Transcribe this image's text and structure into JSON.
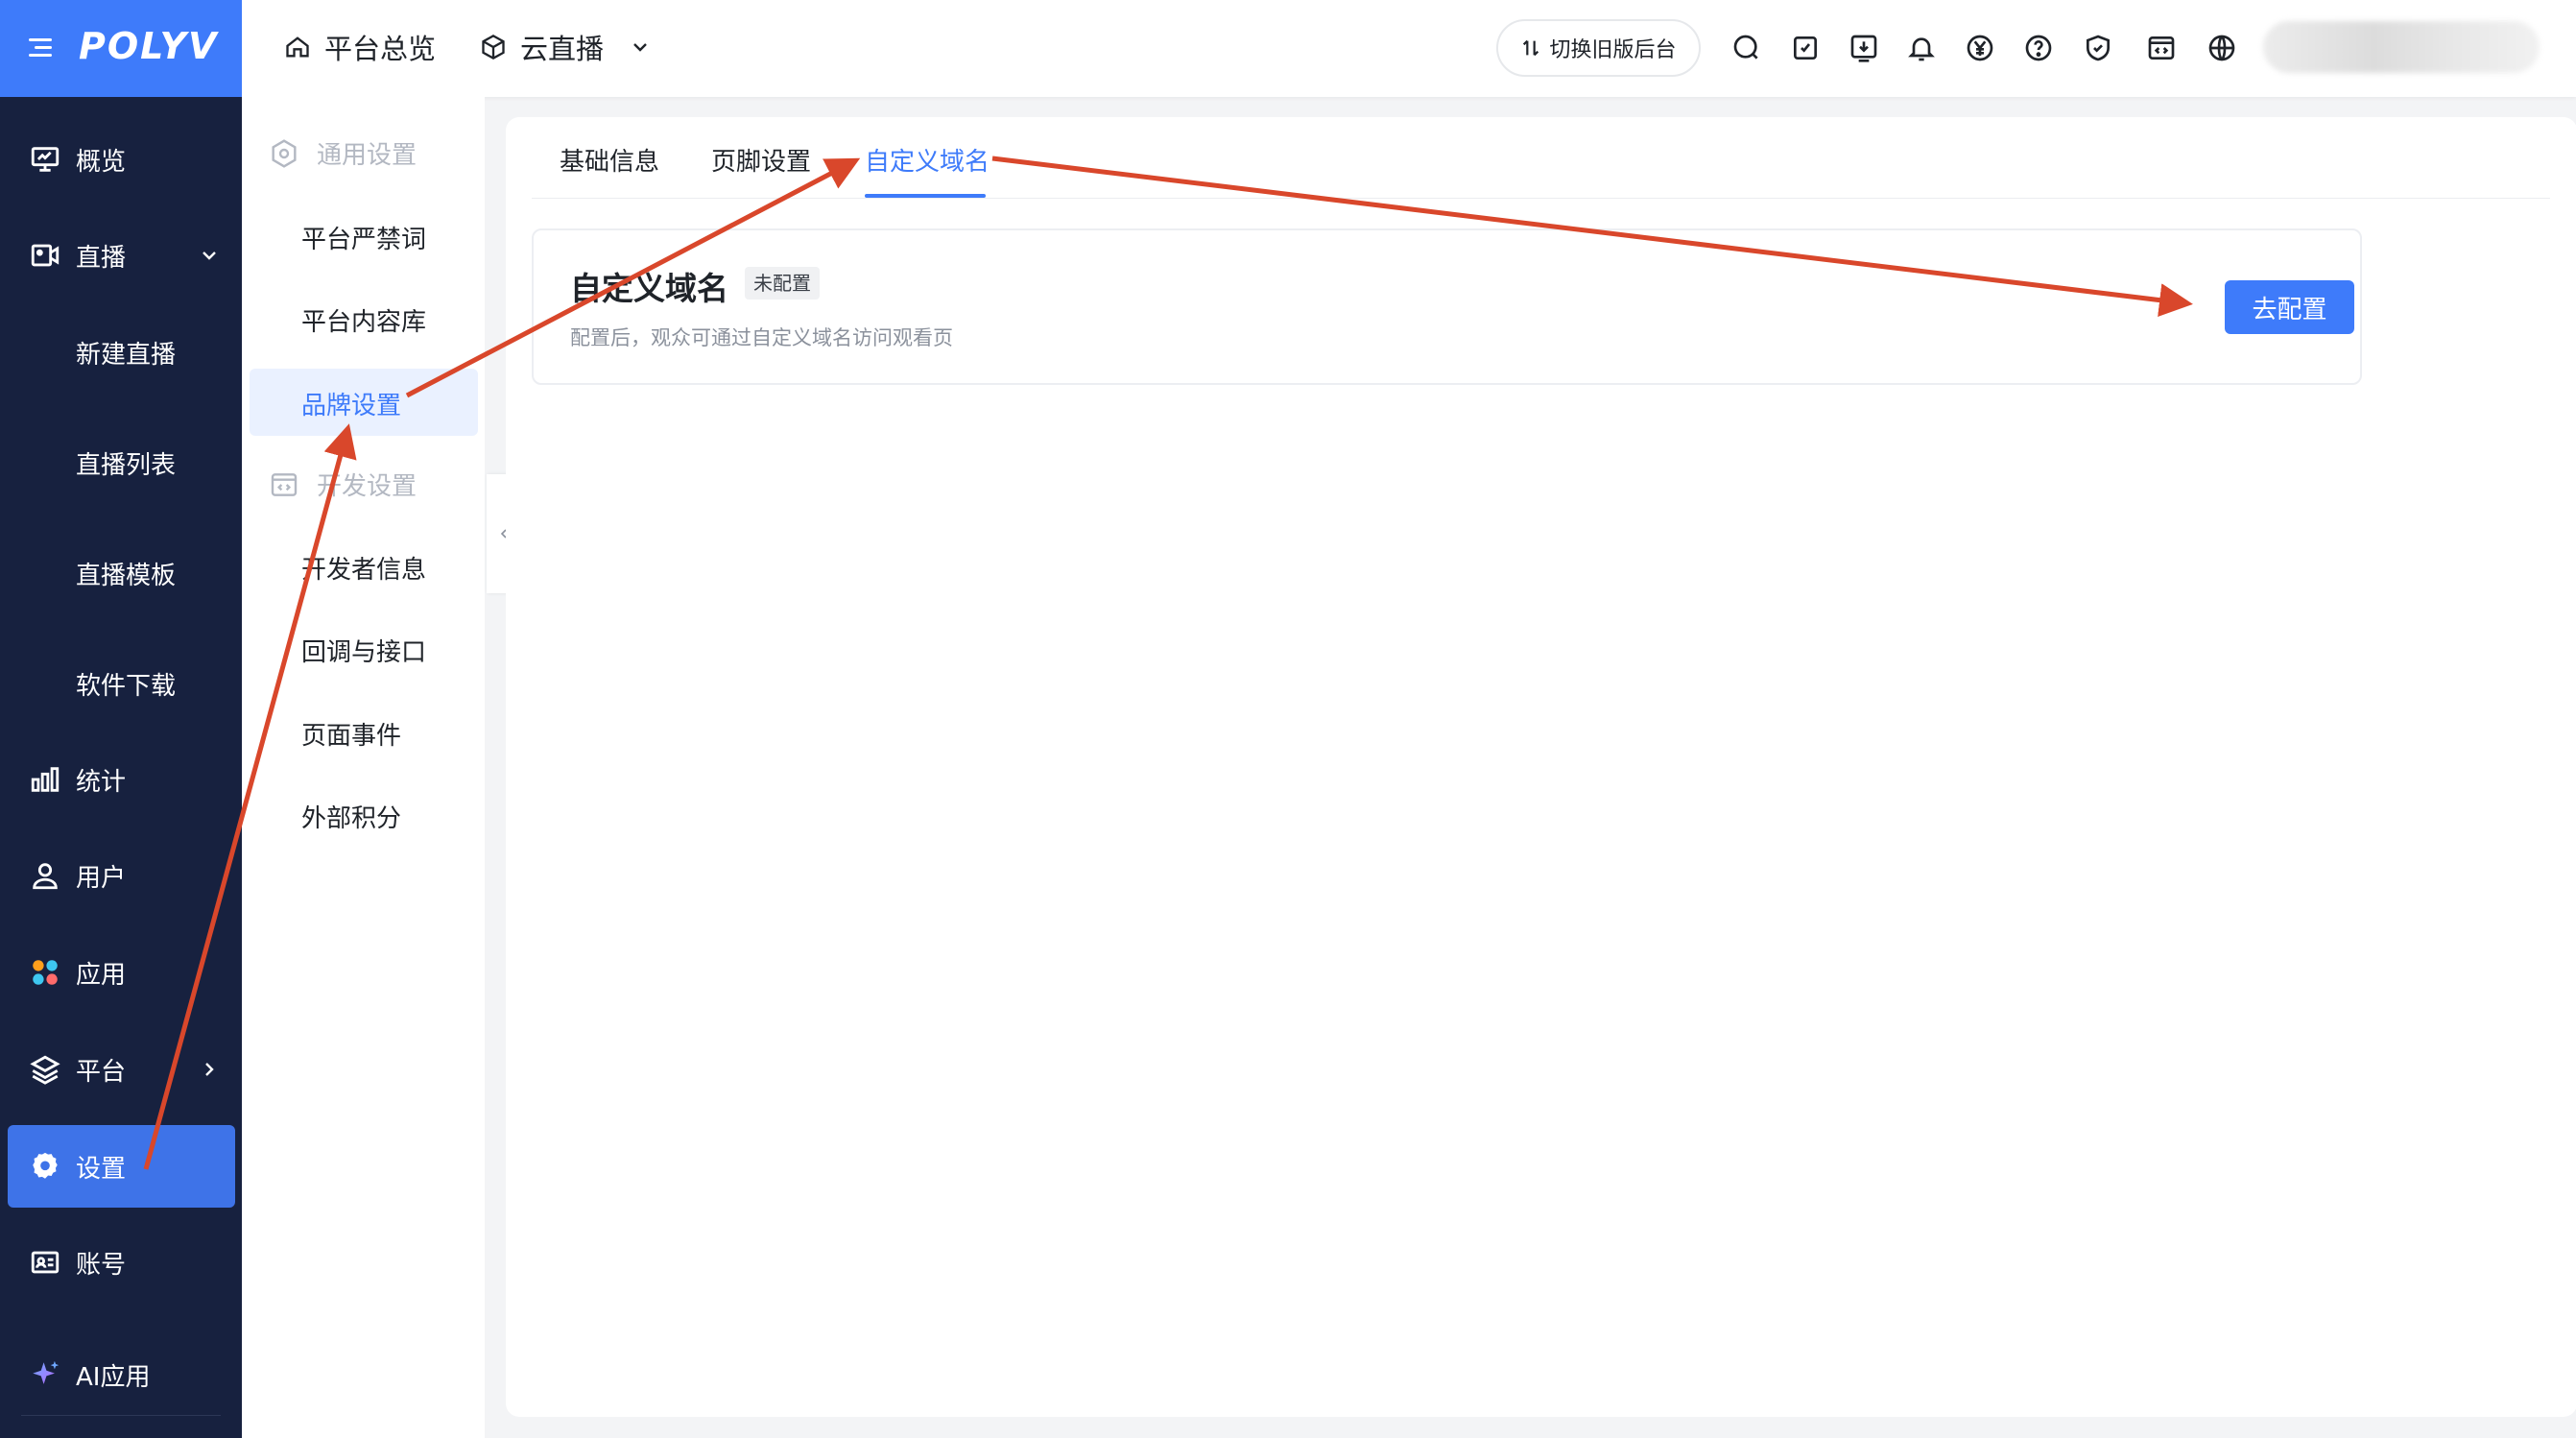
{
  "header": {
    "logo_text": "POLYV",
    "nav": [
      {
        "label": "平台总览",
        "icon": "home-icon"
      },
      {
        "label": "云直播",
        "icon": "cube-icon"
      }
    ],
    "switch_label": "切换旧版后台",
    "icons": [
      "search-icon",
      "task-icon",
      "download-icon",
      "bell-icon",
      "yen-icon",
      "help-icon",
      "shield-icon",
      "code-window-icon",
      "globe-icon"
    ]
  },
  "sidebar": {
    "items": [
      {
        "label": "概览",
        "icon": "monitor-icon"
      },
      {
        "label": "直播",
        "icon": "video-icon"
      },
      {
        "label": "新建直播"
      },
      {
        "label": "直播列表"
      },
      {
        "label": "直播模板"
      },
      {
        "label": "软件下载"
      },
      {
        "label": "统计",
        "icon": "bar-chart-icon"
      },
      {
        "label": "用户",
        "icon": "user-icon"
      },
      {
        "label": "应用",
        "icon": "apps-icon"
      },
      {
        "label": "平台",
        "icon": "layers-icon"
      },
      {
        "label": "设置",
        "icon": "gear-icon"
      },
      {
        "label": "账号",
        "icon": "id-card-icon"
      },
      {
        "label": "AI应用",
        "icon": "sparkle-icon"
      }
    ],
    "active": "设置"
  },
  "subnav": {
    "groups": [
      {
        "title": "通用设置",
        "icon": "hexagon-gear-icon",
        "items": [
          "平台严禁词",
          "平台内容库",
          "品牌设置"
        ]
      },
      {
        "title": "开发设置",
        "icon": "code-window-icon",
        "items": [
          "开发者信息",
          "回调与接口",
          "页面事件",
          "外部积分"
        ]
      }
    ],
    "active": "品牌设置"
  },
  "main": {
    "tabs": [
      "基础信息",
      "页脚设置",
      "自定义域名"
    ],
    "active_tab": "自定义域名",
    "card": {
      "title": "自定义域名",
      "badge": "未配置",
      "description": "配置后，观众可通过自定义域名访问观看页",
      "button": "去配置"
    }
  },
  "colors": {
    "brand": "#3e7bfa",
    "sidebar_bg": "#17213f",
    "annotation_arrow": "#d9472b"
  }
}
